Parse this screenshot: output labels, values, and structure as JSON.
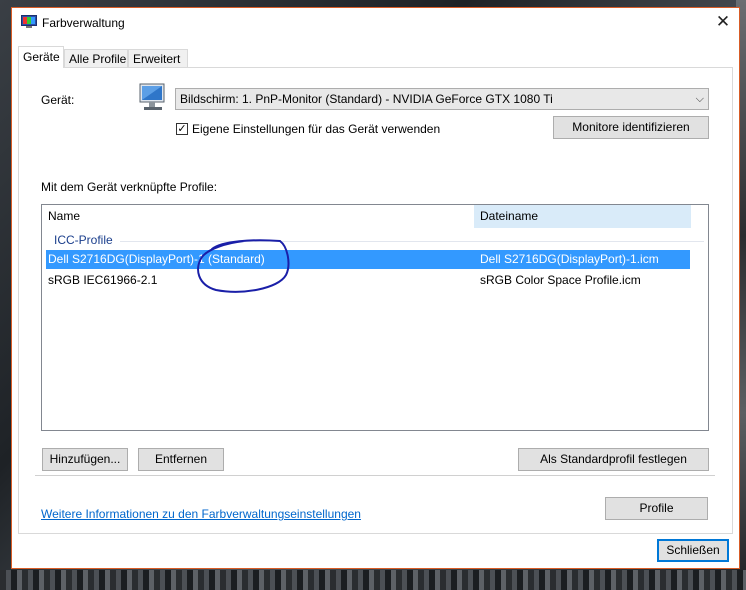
{
  "window": {
    "title": "Farbverwaltung"
  },
  "tabs": [
    {
      "label": "Geräte",
      "active": true
    },
    {
      "label": "Alle Profile",
      "active": false
    },
    {
      "label": "Erweitert",
      "active": false
    }
  ],
  "device": {
    "label": "Gerät:",
    "selected": "Bildschirm: 1. PnP-Monitor (Standard) - NVIDIA GeForce GTX 1080 Ti",
    "own_settings_label": "Eigene Einstellungen für das Gerät verwenden",
    "own_settings_checked": true,
    "identify_button": "Monitore identifizieren"
  },
  "profiles": {
    "section_label": "Mit dem Gerät verknüpfte Profile:",
    "columns": [
      "Name",
      "Dateiname"
    ],
    "group": "ICC-Profile",
    "rows": [
      {
        "name": "Dell S2716DG(DisplayPort)-1 (Standard)",
        "file": "Dell S2716DG(DisplayPort)-1.icm",
        "selected": true
      },
      {
        "name": "sRGB IEC61966-2.1",
        "file": "sRGB Color Space Profile.icm",
        "selected": false
      }
    ],
    "annotation_color": "#1a1fa8"
  },
  "buttons": {
    "add": "Hinzufügen...",
    "remove": "Entfernen",
    "set_default": "Als Standardprofil festlegen",
    "profile": "Profile",
    "close": "Schließen"
  },
  "more_info_link": "Weitere Informationen zu den Farbverwaltungseinstellungen",
  "colors": {
    "accent": "#0078d7",
    "selection": "#3399ff",
    "link": "#0066cc",
    "window_border": "#d85c26"
  }
}
